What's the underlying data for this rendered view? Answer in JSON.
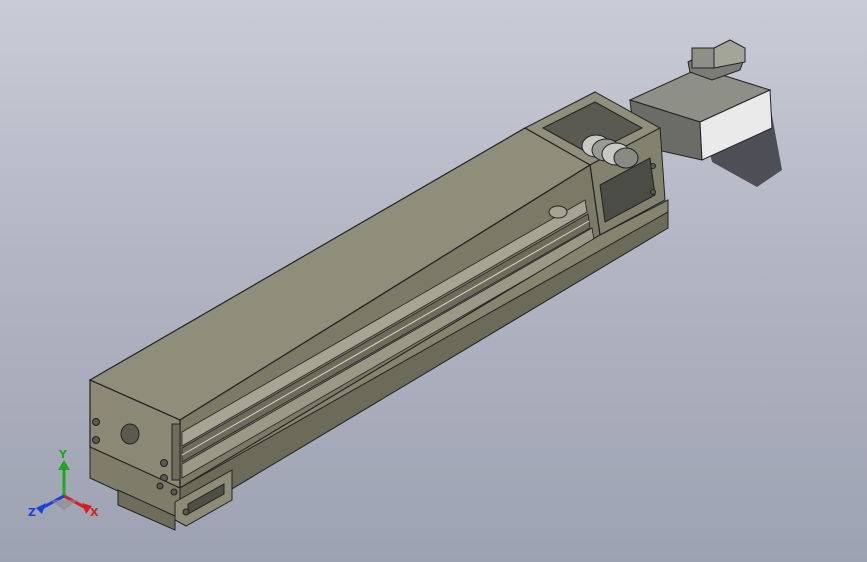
{
  "triad": {
    "x_label": "X",
    "y_label": "Y",
    "z_label": "Z",
    "x_color": "#d42020",
    "y_color": "#1fa81f",
    "z_color": "#2040d8"
  },
  "model": {
    "body_color": "#8d8c78",
    "cover_color": "#7a7966",
    "motor_color": "#e8e8e8"
  }
}
